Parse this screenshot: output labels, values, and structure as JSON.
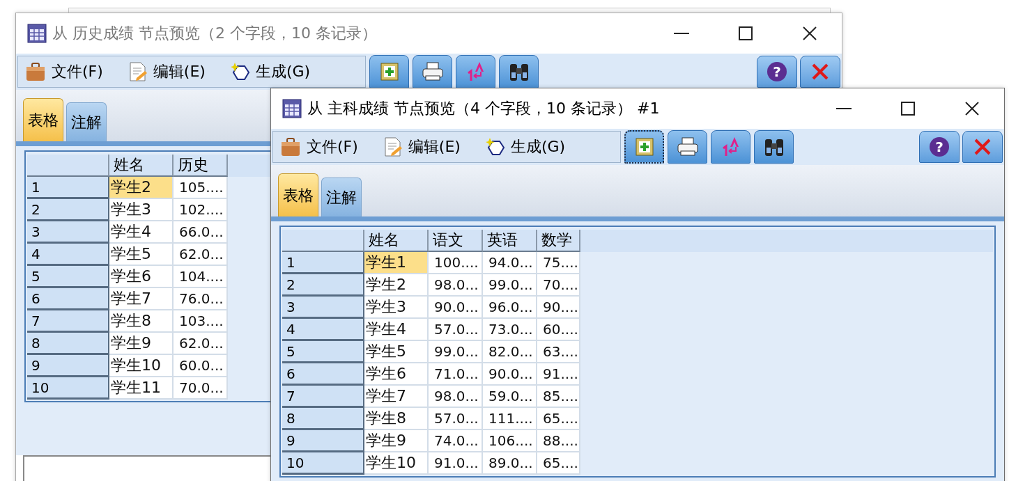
{
  "windows": [
    {
      "title": "从 历史成绩 节点预览（2 个字段，10 条记录）",
      "active": false,
      "menu": [
        "文件(F)",
        "编辑(E)",
        "生成(G)"
      ],
      "tools": [
        {
          "kind": "add-table",
          "focused": false
        },
        {
          "kind": "print",
          "focused": false
        },
        {
          "kind": "sort",
          "focused": false
        },
        {
          "kind": "find",
          "focused": false
        }
      ],
      "help_label": "?",
      "tabs": [
        {
          "label": "表格",
          "selected": true
        },
        {
          "label": "注解",
          "selected": false
        }
      ],
      "table": {
        "columns": [
          "姓名",
          "历史"
        ],
        "rows": [
          {
            "index": "1",
            "cells": [
              "学生2",
              "105...."
            ],
            "selected": true
          },
          {
            "index": "2",
            "cells": [
              "学生3",
              "102...."
            ],
            "selected": false
          },
          {
            "index": "3",
            "cells": [
              "学生4",
              "66.0..."
            ],
            "selected": false
          },
          {
            "index": "4",
            "cells": [
              "学生5",
              "62.0..."
            ],
            "selected": false
          },
          {
            "index": "5",
            "cells": [
              "学生6",
              "104...."
            ],
            "selected": false
          },
          {
            "index": "6",
            "cells": [
              "学生7",
              "76.0..."
            ],
            "selected": false
          },
          {
            "index": "7",
            "cells": [
              "学生8",
              "103...."
            ],
            "selected": false
          },
          {
            "index": "8",
            "cells": [
              "学生9",
              "62.0..."
            ],
            "selected": false
          },
          {
            "index": "9",
            "cells": [
              "学生10",
              "60.0..."
            ],
            "selected": false
          },
          {
            "index": "10",
            "cells": [
              "学生11",
              "70.0..."
            ],
            "selected": false
          }
        ]
      }
    },
    {
      "title": "从 主科成绩 节点预览（4 个字段，10 条记录） #1",
      "active": true,
      "menu": [
        "文件(F)",
        "编辑(E)",
        "生成(G)"
      ],
      "tools": [
        {
          "kind": "add-table",
          "focused": true
        },
        {
          "kind": "print",
          "focused": false
        },
        {
          "kind": "sort",
          "focused": false
        },
        {
          "kind": "find",
          "focused": false
        }
      ],
      "help_label": "?",
      "tabs": [
        {
          "label": "表格",
          "selected": true
        },
        {
          "label": "注解",
          "selected": false
        }
      ],
      "table": {
        "columns": [
          "姓名",
          "语文",
          "英语",
          "数学"
        ],
        "rows": [
          {
            "index": "1",
            "cells": [
              "学生1",
              "100....",
              "94.0...",
              "75...."
            ],
            "selected": true
          },
          {
            "index": "2",
            "cells": [
              "学生2",
              "98.0...",
              "99.0...",
              "70...."
            ],
            "selected": false
          },
          {
            "index": "3",
            "cells": [
              "学生3",
              "90.0...",
              "96.0...",
              "90...."
            ],
            "selected": false
          },
          {
            "index": "4",
            "cells": [
              "学生4",
              "57.0...",
              "73.0...",
              "60...."
            ],
            "selected": false
          },
          {
            "index": "5",
            "cells": [
              "学生5",
              "99.0...",
              "82.0...",
              "63...."
            ],
            "selected": false
          },
          {
            "index": "6",
            "cells": [
              "学生6",
              "71.0...",
              "90.0...",
              "91...."
            ],
            "selected": false
          },
          {
            "index": "7",
            "cells": [
              "学生7",
              "98.0...",
              "59.0...",
              "85...."
            ],
            "selected": false
          },
          {
            "index": "8",
            "cells": [
              "学生8",
              "57.0...",
              "111....",
              "65...."
            ],
            "selected": false
          },
          {
            "index": "9",
            "cells": [
              "学生9",
              "74.0...",
              "106....",
              "88...."
            ],
            "selected": false
          },
          {
            "index": "10",
            "cells": [
              "学生10",
              "91.0...",
              "89.0...",
              "65...."
            ],
            "selected": false
          }
        ]
      }
    }
  ]
}
